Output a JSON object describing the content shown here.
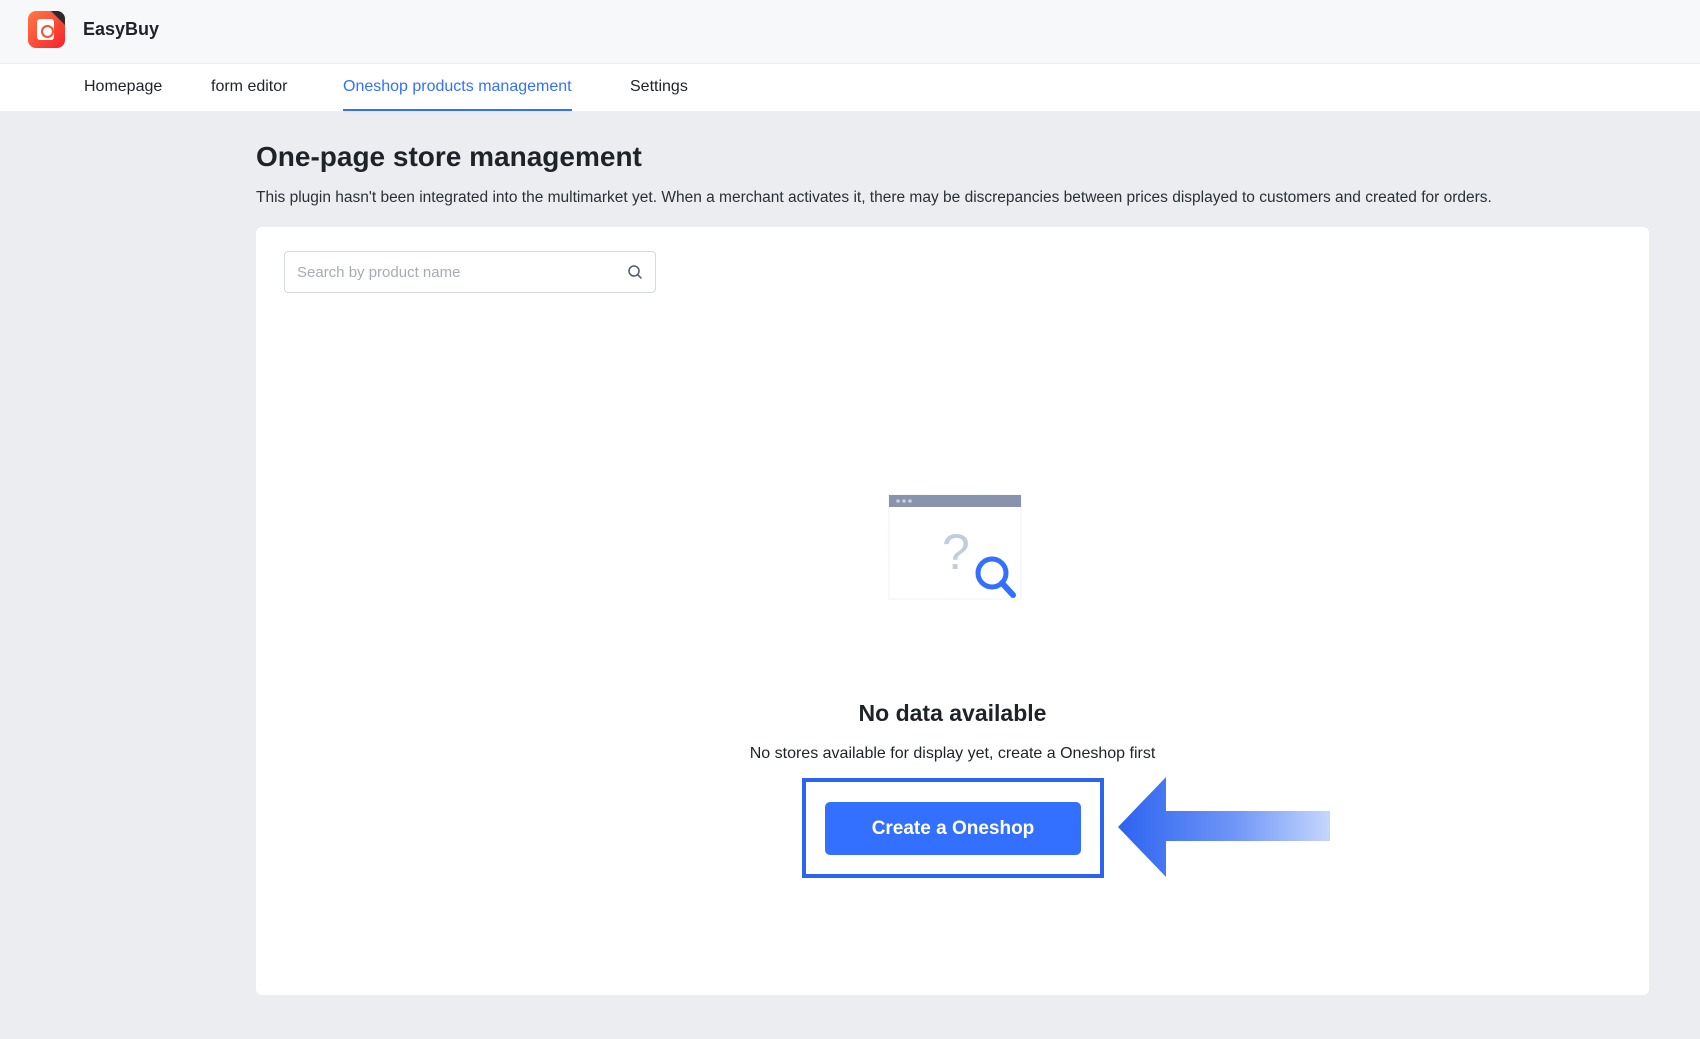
{
  "app": {
    "name": "EasyBuy",
    "logo_icon": "easybuy-logo-icon"
  },
  "nav": {
    "items": [
      {
        "label": "Homepage",
        "active": false
      },
      {
        "label": "form editor",
        "active": false
      },
      {
        "label": "Oneshop products management",
        "active": true
      },
      {
        "label": "Settings",
        "active": false
      }
    ]
  },
  "page": {
    "title": "One-page store management",
    "description": "This plugin hasn't been integrated into the multimarket yet. When a merchant activates it, there may be discrepancies between prices displayed to customers and created for orders."
  },
  "search": {
    "placeholder": "Search by product name",
    "value": "",
    "icon": "search-icon"
  },
  "empty_state": {
    "illustration_icon": "empty-search-illustration-icon",
    "title": "No data available",
    "description": "No stores available for display yet, create a Oneshop first",
    "button_label": "Create a Oneshop"
  },
  "colors": {
    "accent": "#3370ff",
    "highlight": "#2c63f0",
    "background": "#ebedf1"
  }
}
